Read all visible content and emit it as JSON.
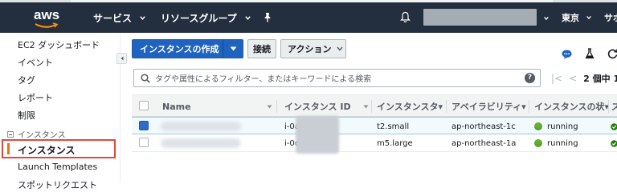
{
  "nav": {
    "logo_text": "aws",
    "services": "サービス",
    "resource_groups": "リソースグループ",
    "region": "東京",
    "support": "サポ"
  },
  "sidebar": {
    "items": [
      "EC2 ダッシュボード",
      "イベント",
      "タグ",
      "レポート",
      "制限"
    ],
    "section": "インスタンス",
    "active_item": "インスタンス",
    "items_after": [
      "Launch Templates",
      "スポットリクエスト"
    ]
  },
  "toolbar": {
    "create_label": "インスタンスの作成",
    "connect_label": "接続",
    "actions_label": "アクション"
  },
  "search": {
    "placeholder": "タグや属性によるフィルター、またはキーワードによる検索",
    "help": "?"
  },
  "pager": {
    "text": "2 個中 1 -"
  },
  "table": {
    "headers": [
      "Name",
      "インスタンス ID",
      "インスタンスタ▾",
      "アベイラビリティ▾",
      "インスタンスの状▾",
      "ス"
    ],
    "rows": [
      {
        "id_prefix": "i-0a0",
        "type": "t2.small",
        "az": "ap-northeast-1c",
        "state": "running",
        "selected": true
      },
      {
        "id_prefix": "i-0ea",
        "type": "m5.large",
        "az": "ap-northeast-1a",
        "state": "running",
        "selected": false
      }
    ]
  },
  "colors": {
    "navbar": "#232f3e",
    "primary_button": "#1e63bf",
    "running": "#64b22e",
    "active_accent": "#ec7211",
    "highlight_border": "#e0493a"
  }
}
